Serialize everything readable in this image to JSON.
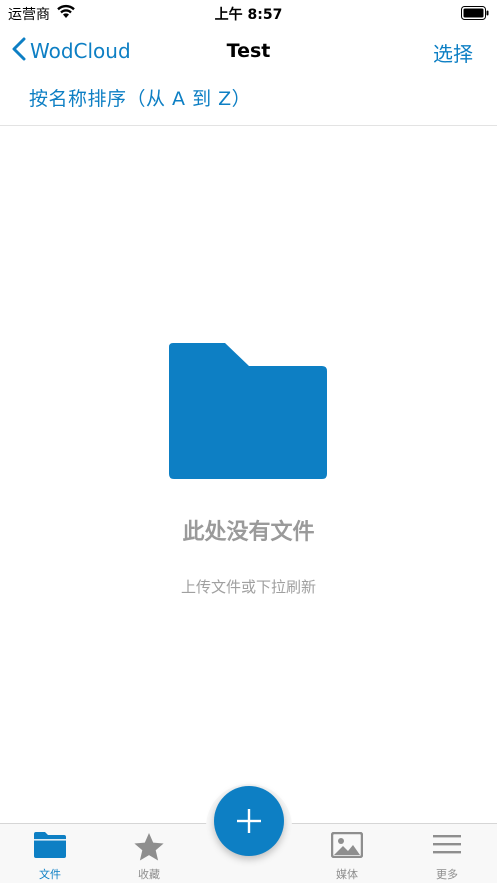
{
  "status_bar": {
    "carrier": "运营商",
    "time": "上午 8:57"
  },
  "nav": {
    "back_label": "WodCloud",
    "title": "Test",
    "select_label": "选择"
  },
  "sort": {
    "label": "按名称排序（从 A 到 Z）"
  },
  "empty_state": {
    "title": "此处没有文件",
    "subtitle": "上传文件或下拉刷新"
  },
  "tab_bar": {
    "tabs": [
      {
        "label": "文件",
        "icon": "folder-icon",
        "active": true
      },
      {
        "label": "收藏",
        "icon": "star-icon",
        "active": false
      },
      {
        "label": "媒体",
        "icon": "image-icon",
        "active": false
      },
      {
        "label": "更多",
        "icon": "menu-icon",
        "active": false
      }
    ],
    "fab_icon": "plus-icon"
  },
  "colors": {
    "accent": "#0d7fc4",
    "inactive": "#8e8e8e",
    "empty_text": "#9a9a9a"
  }
}
